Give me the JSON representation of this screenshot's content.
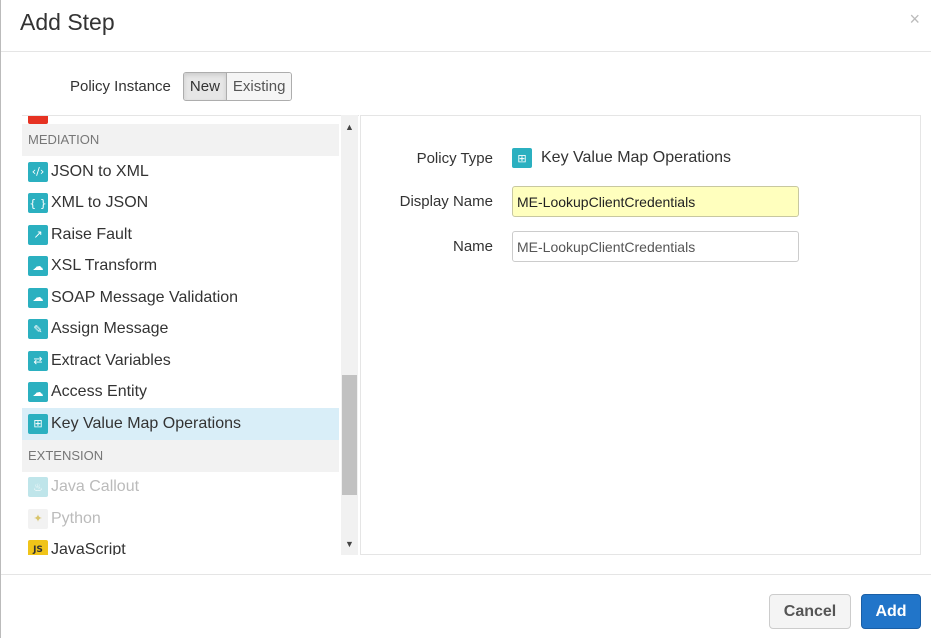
{
  "dialog": {
    "title": "Add Step",
    "close_glyph": "×"
  },
  "policy_instance": {
    "label": "Policy Instance",
    "options": [
      "New",
      "Existing"
    ],
    "selected": "New"
  },
  "policy_list": {
    "categories": [
      {
        "name": "MEDIATION",
        "items": [
          {
            "label": "JSON to XML",
            "icon": "json-to-xml-icon",
            "glyph": "‹/›"
          },
          {
            "label": "XML to JSON",
            "icon": "xml-to-json-icon",
            "glyph": "{ }"
          },
          {
            "label": "Raise Fault",
            "icon": "raise-fault-icon",
            "glyph": "↗"
          },
          {
            "label": "XSL Transform",
            "icon": "xsl-transform-icon",
            "glyph": "☁"
          },
          {
            "label": "SOAP Message Validation",
            "icon": "soap-validation-icon",
            "glyph": "☁"
          },
          {
            "label": "Assign Message",
            "icon": "assign-message-icon",
            "glyph": "✎"
          },
          {
            "label": "Extract Variables",
            "icon": "extract-variables-icon",
            "glyph": "⇄"
          },
          {
            "label": "Access Entity",
            "icon": "access-entity-icon",
            "glyph": "☁"
          },
          {
            "label": "Key Value Map Operations",
            "icon": "key-value-map-icon",
            "glyph": "⊞",
            "selected": true
          }
        ]
      },
      {
        "name": "EXTENSION",
        "items": [
          {
            "label": "Java Callout",
            "icon": "java-callout-icon",
            "glyph": "♨",
            "disabled": true
          },
          {
            "label": "Python",
            "icon": "python-icon",
            "glyph": "✦",
            "disabled": true
          },
          {
            "label": "JavaScript",
            "icon": "javascript-icon",
            "glyph": "JS"
          }
        ]
      }
    ]
  },
  "details": {
    "policy_type_label": "Policy Type",
    "policy_type_value": "Key Value Map Operations",
    "display_name_label": "Display Name",
    "display_name_value": "ME-LookupClientCredentials",
    "name_label": "Name",
    "name_value": "ME-LookupClientCredentials"
  },
  "footer": {
    "cancel_label": "Cancel",
    "add_label": "Add"
  },
  "colors": {
    "accent": "#2175c9",
    "icon_teal": "#2bb0c0",
    "selected_row": "#d9eef8",
    "highlight_input": "#ffffbe"
  }
}
